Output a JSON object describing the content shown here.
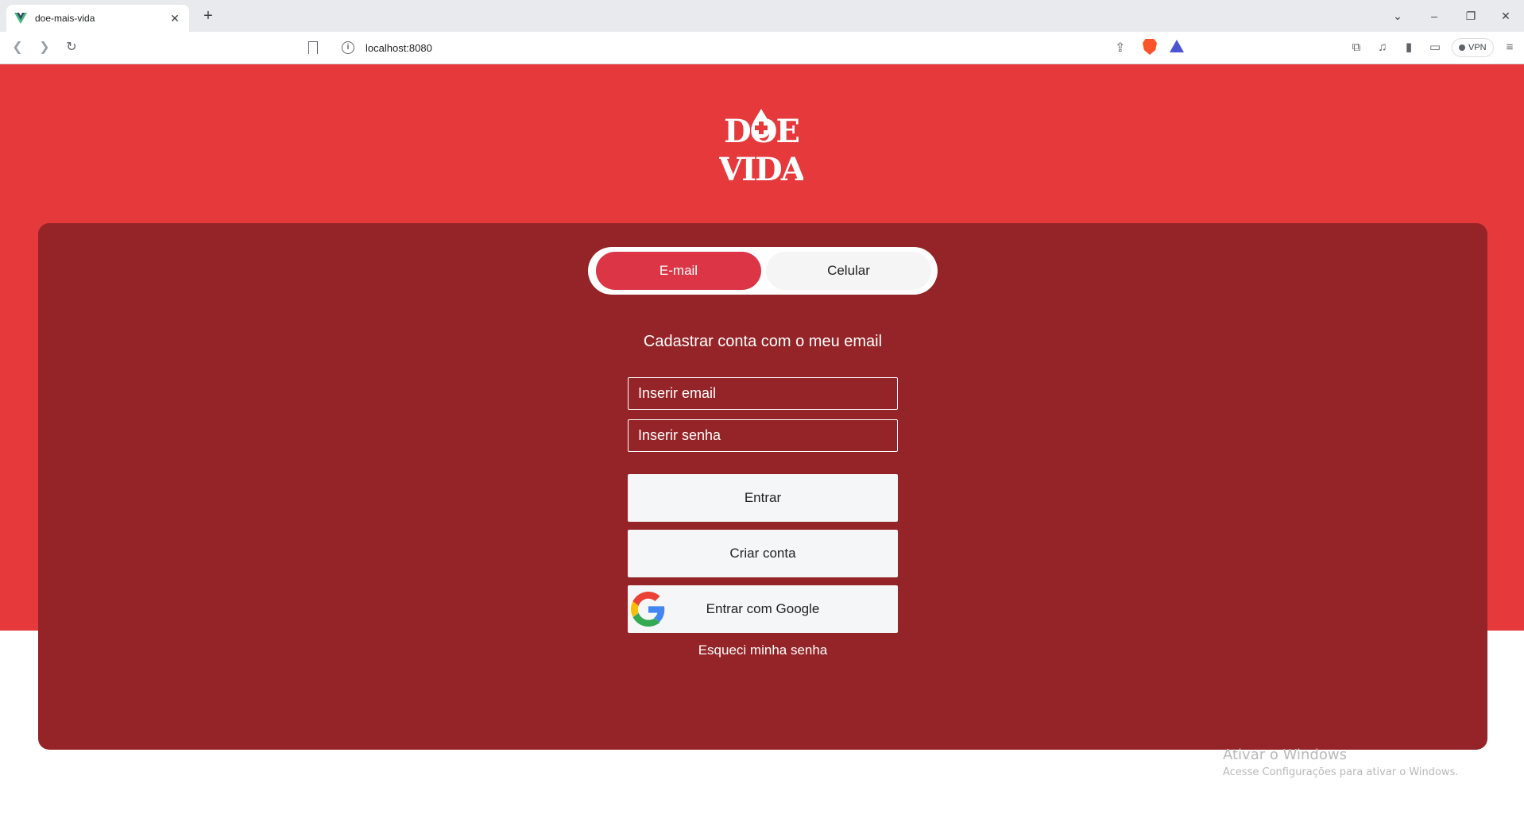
{
  "browser": {
    "tab_title": "doe-mais-vida",
    "url": "localhost:8080",
    "vpn_label": "VPN"
  },
  "icons": {
    "back": "back-arrow-icon",
    "forward": "forward-arrow-icon",
    "reload": "reload-icon",
    "bookmark": "bookmark-icon",
    "site_info": "site-info-icon",
    "share": "share-icon",
    "brave_shields": "brave-shields-icon",
    "rewards": "brave-rewards-icon",
    "extensions": "extensions-icon",
    "media": "media-icon",
    "sidebar": "sidebar-icon",
    "wallet": "wallet-icon",
    "menu": "menu-icon",
    "google": "google-icon"
  },
  "colors": {
    "brand_red": "#e5393b",
    "card_dark_red": "#942427",
    "active_tab": "#dc3546"
  },
  "logo": {
    "line1": "DOE",
    "line2": "VIDA"
  },
  "toggle": {
    "email": "E-mail",
    "phone": "Celular",
    "selected": "E-mail"
  },
  "form": {
    "title": "Cadastrar conta com o meu email",
    "email_placeholder": "Inserir email",
    "password_placeholder": "Inserir senha",
    "enter_label": "Entrar",
    "create_label": "Criar conta",
    "google_label": "Entrar com Google",
    "forgot_label": "Esqueci minha senha"
  },
  "watermark": {
    "title": "Ativar o Windows",
    "subtitle": "Acesse Configurações para ativar o Windows."
  }
}
